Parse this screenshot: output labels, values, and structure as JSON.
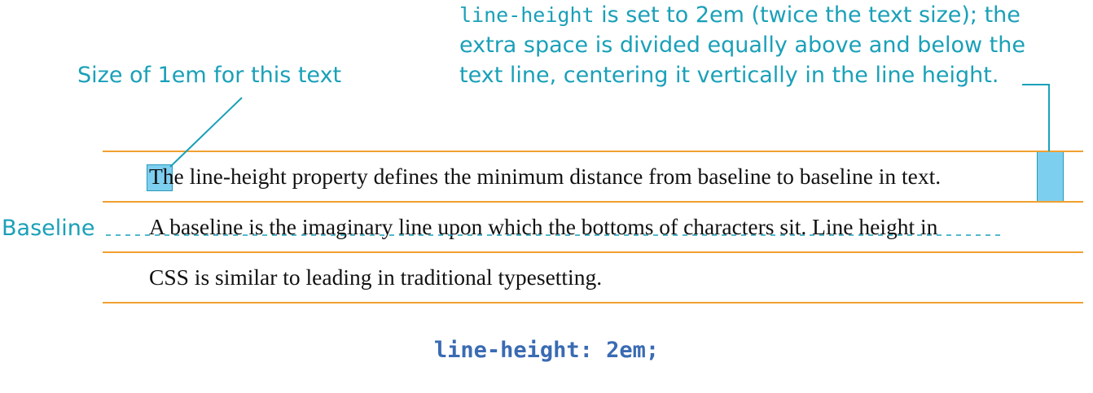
{
  "note": {
    "code_term": "line-height",
    "line1_rest": " is set to 2em (twice the text size); the",
    "line2": "extra space is divided equally above and below the",
    "line3": "text line, centering it  vertically in the line height."
  },
  "em_label": "Size of 1em for this text",
  "baseline_label": "Baseline",
  "sample_lines": [
    "The line-height property defines the minimum distance from baseline to baseline in text.",
    "A baseline is the imaginary line upon which the bottoms of characters sit. Line height in",
    "CSS is similar to leading in traditional typesetting."
  ],
  "caption": "line-height: 2em;",
  "colors": {
    "annotation": "#1aa0b8",
    "rules": "#f0a030",
    "highlight": "#7dcff0",
    "caption": "#3a6bb3"
  }
}
